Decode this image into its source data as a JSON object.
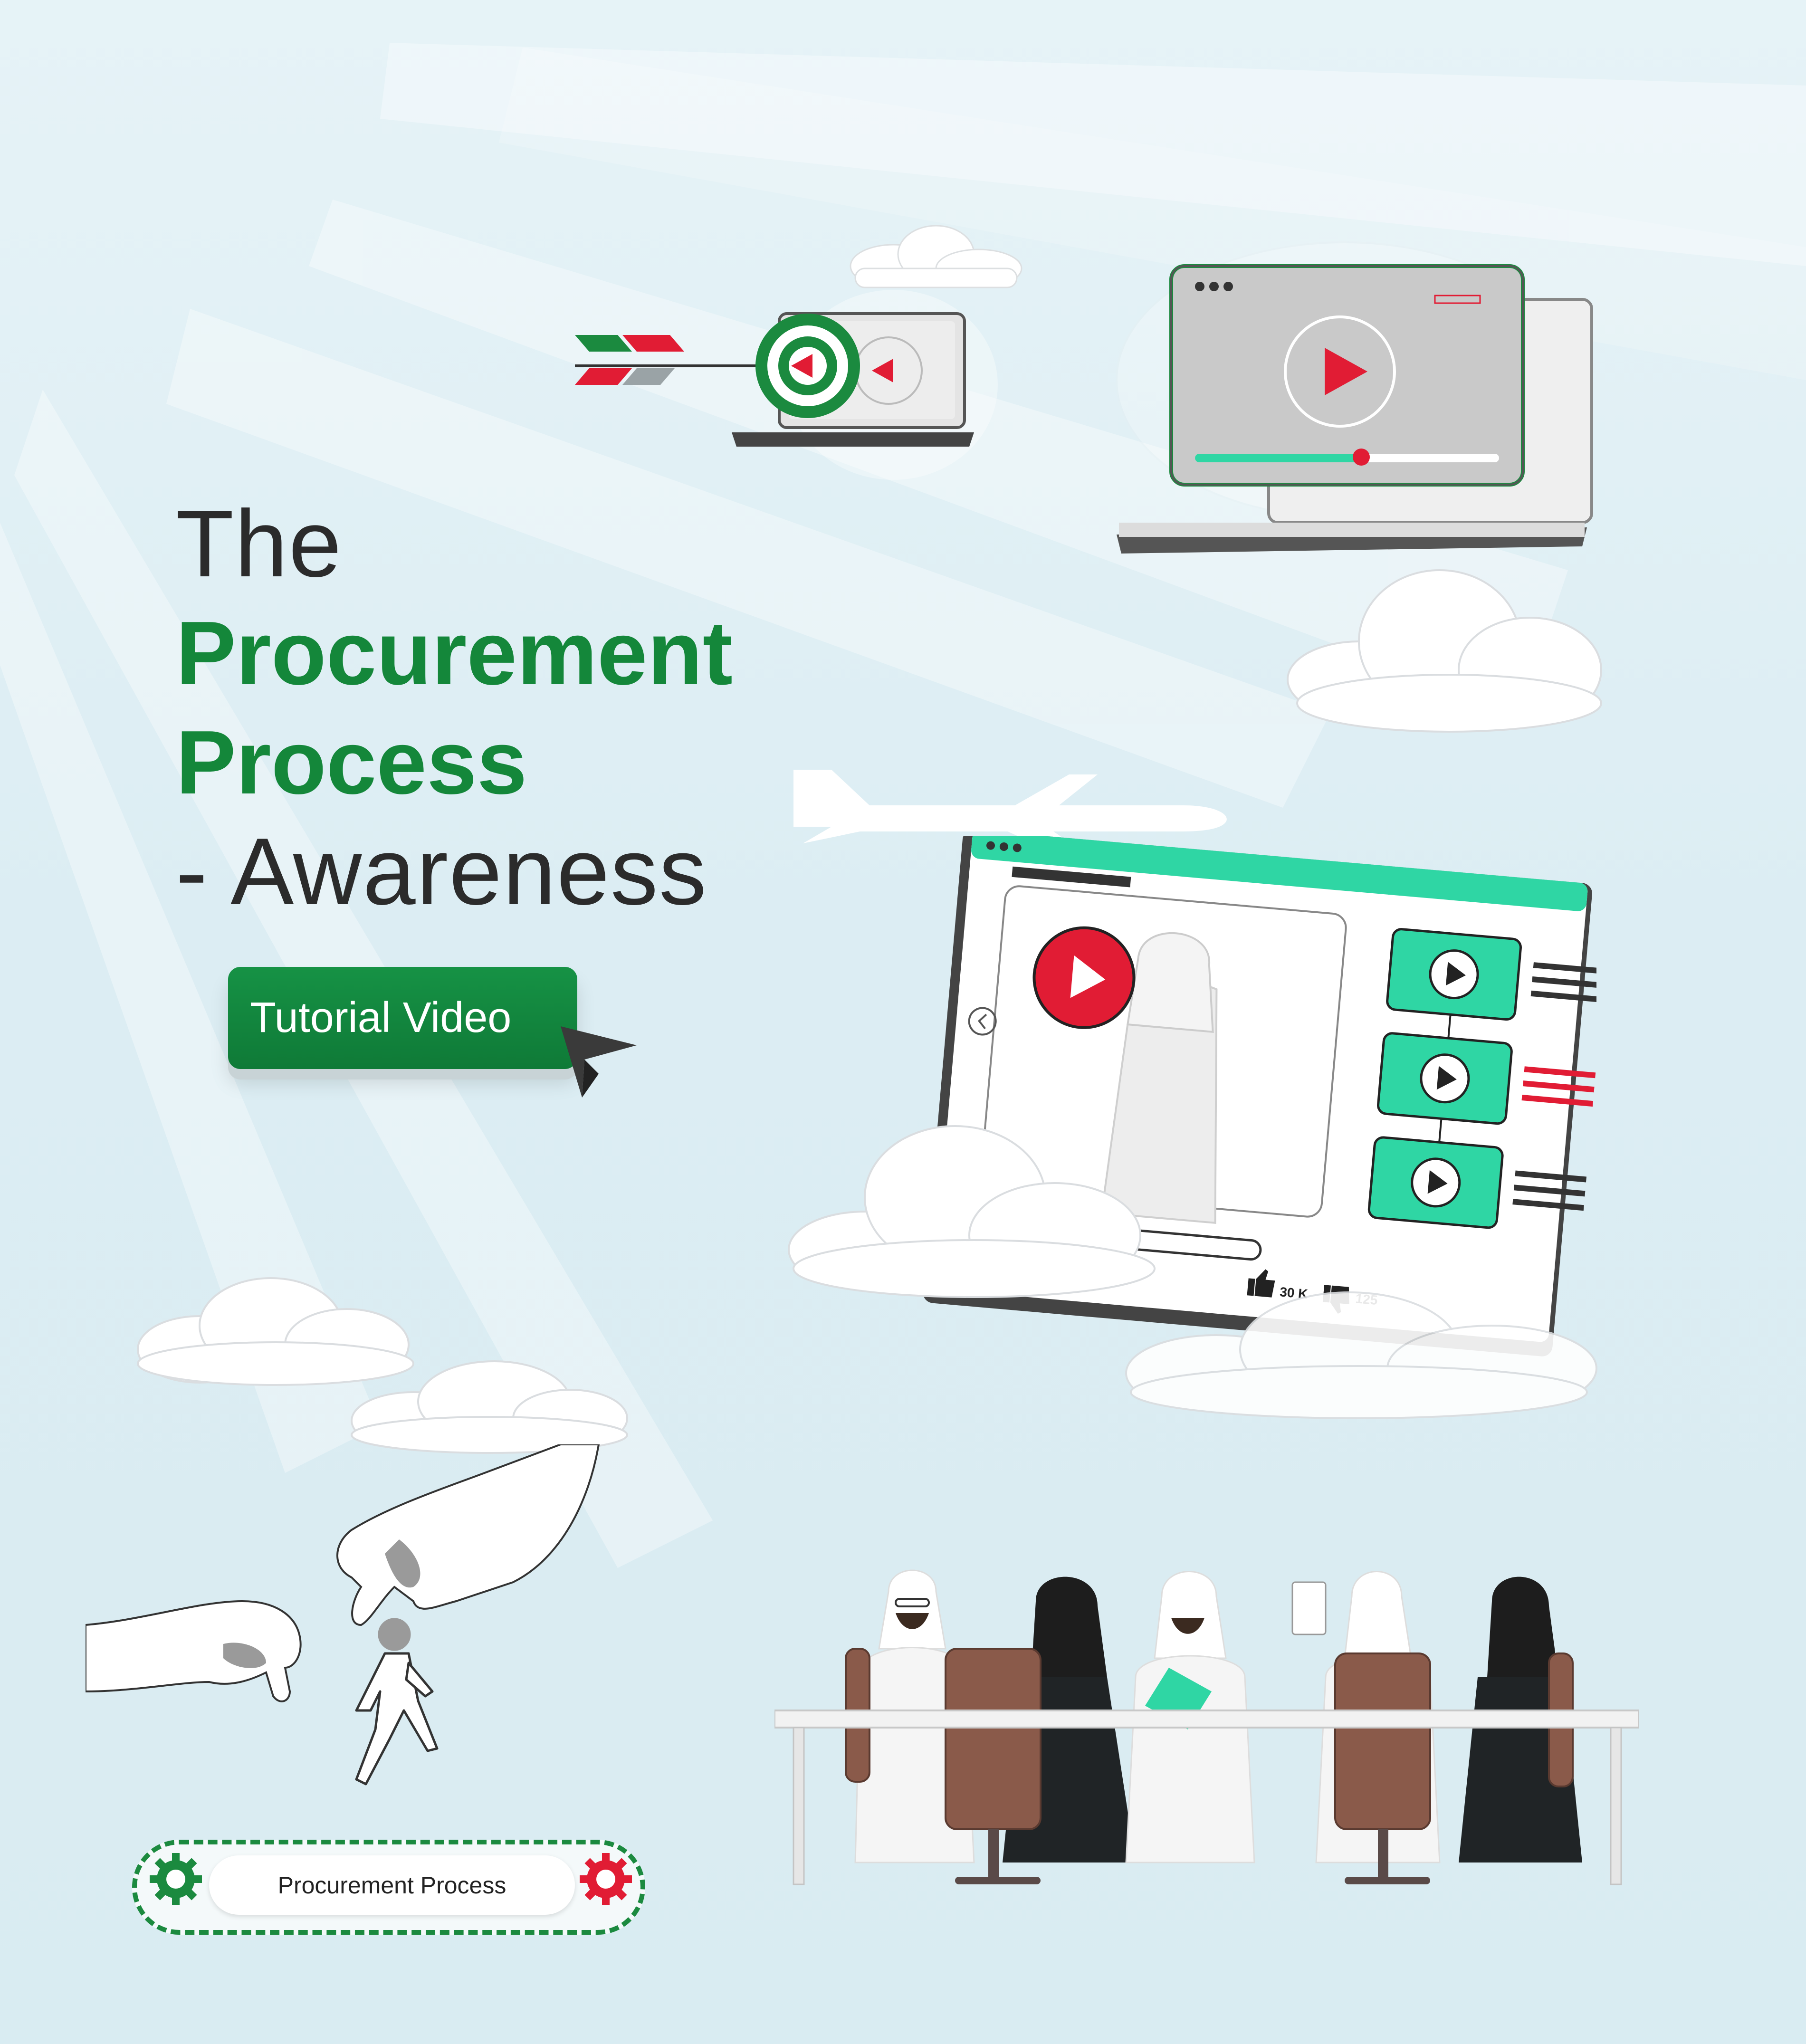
{
  "hero": {
    "line1": "The",
    "line2": "Procurement",
    "line3": "Process",
    "line4": "- Awareness"
  },
  "cta": {
    "label": "Tutorial Video"
  },
  "video_panel": {
    "likes": "30 K",
    "dislikes": "125"
  },
  "conveyor": {
    "label": "Procurement Process"
  },
  "colors": {
    "brand_green": "#14873a",
    "accent_red": "#e11c34",
    "teal": "#2fd6a4",
    "text_dark": "#2b2b2b"
  },
  "icons": [
    "target-icon",
    "play-icon",
    "arrow-cursor-icon",
    "airplane-icon",
    "thumbs-up-icon",
    "thumbs-down-icon",
    "gear-icon",
    "walking-person-icon"
  ]
}
